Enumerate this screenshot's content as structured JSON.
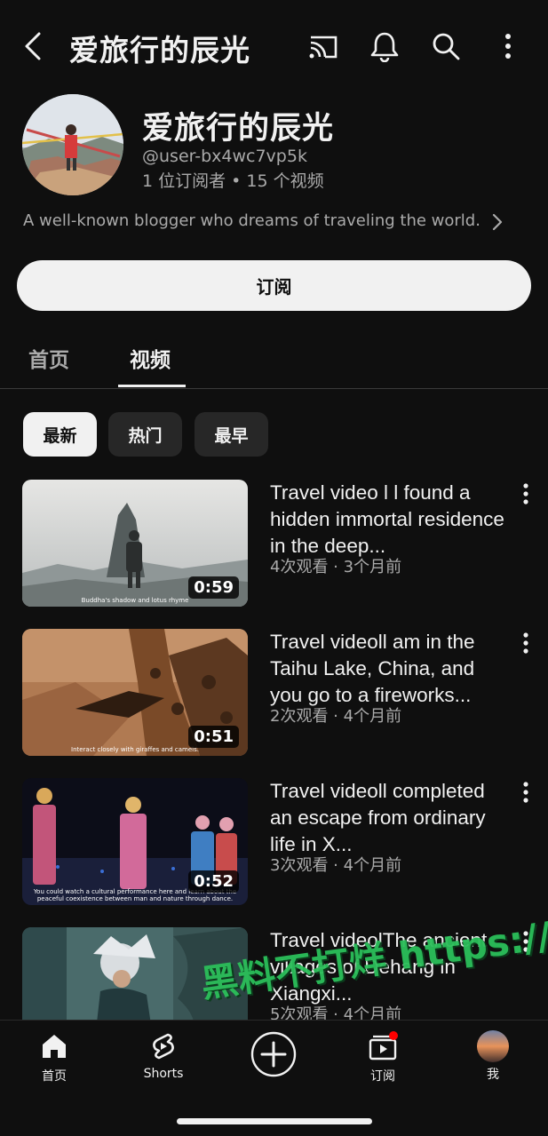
{
  "header": {
    "title": "爱旅行的辰光",
    "icons": [
      "back-icon",
      "cast-icon",
      "bell-icon",
      "search-icon",
      "more-vertical-icon"
    ]
  },
  "channel": {
    "name": "爱旅行的辰光",
    "handle": "@user-bx4wc7vp5k",
    "stats": "1 位订阅者 • 15 个视频",
    "description": "A well-known blogger who dreams of traveling the world.",
    "subscribe_label": "订阅"
  },
  "tabs": [
    {
      "label": "首页",
      "active": false
    },
    {
      "label": "视频",
      "active": true
    }
  ],
  "filters": [
    {
      "label": "最新",
      "active": true
    },
    {
      "label": "热门",
      "active": false
    },
    {
      "label": "最早",
      "active": false
    }
  ],
  "videos": [
    {
      "title": "Travel video l l found a hidden immortal residence in the deep...",
      "meta": "4次观看 · 3个月前",
      "duration": "0:59",
      "caption": "Buddha's shadow and lotus rhyme"
    },
    {
      "title": "Travel videoll am in the Taihu Lake, China, and you go to a fireworks...",
      "meta": "2次观看 · 4个月前",
      "duration": "0:51",
      "caption": "Interact closely with giraffes and camels."
    },
    {
      "title": "Travel videoll completed an escape from ordinary life in X...",
      "meta": "3次观看 · 4个月前",
      "duration": "0:52",
      "caption": "You could watch a cultural performance here and learn about the peaceful coexistence between man and nature through dance."
    },
    {
      "title": "Travel videolThe ancient villages of Dehang in Xiangxi...",
      "meta": "5次观看 · 4个月前",
      "duration": "",
      "caption": ""
    }
  ],
  "bottom_nav": {
    "home": "首页",
    "shorts": "Shorts",
    "subscriptions": "订阅",
    "you": "我"
  },
  "watermark": "黑料不打烊 https://ibdyzi.com",
  "colors": {
    "background": "#0f0f0f",
    "text": "#f1f1f1",
    "secondary_text": "#aaaaaa",
    "chip_bg": "#272727",
    "notification_dot": "#ff0000",
    "watermark": "#2bbf5a"
  }
}
